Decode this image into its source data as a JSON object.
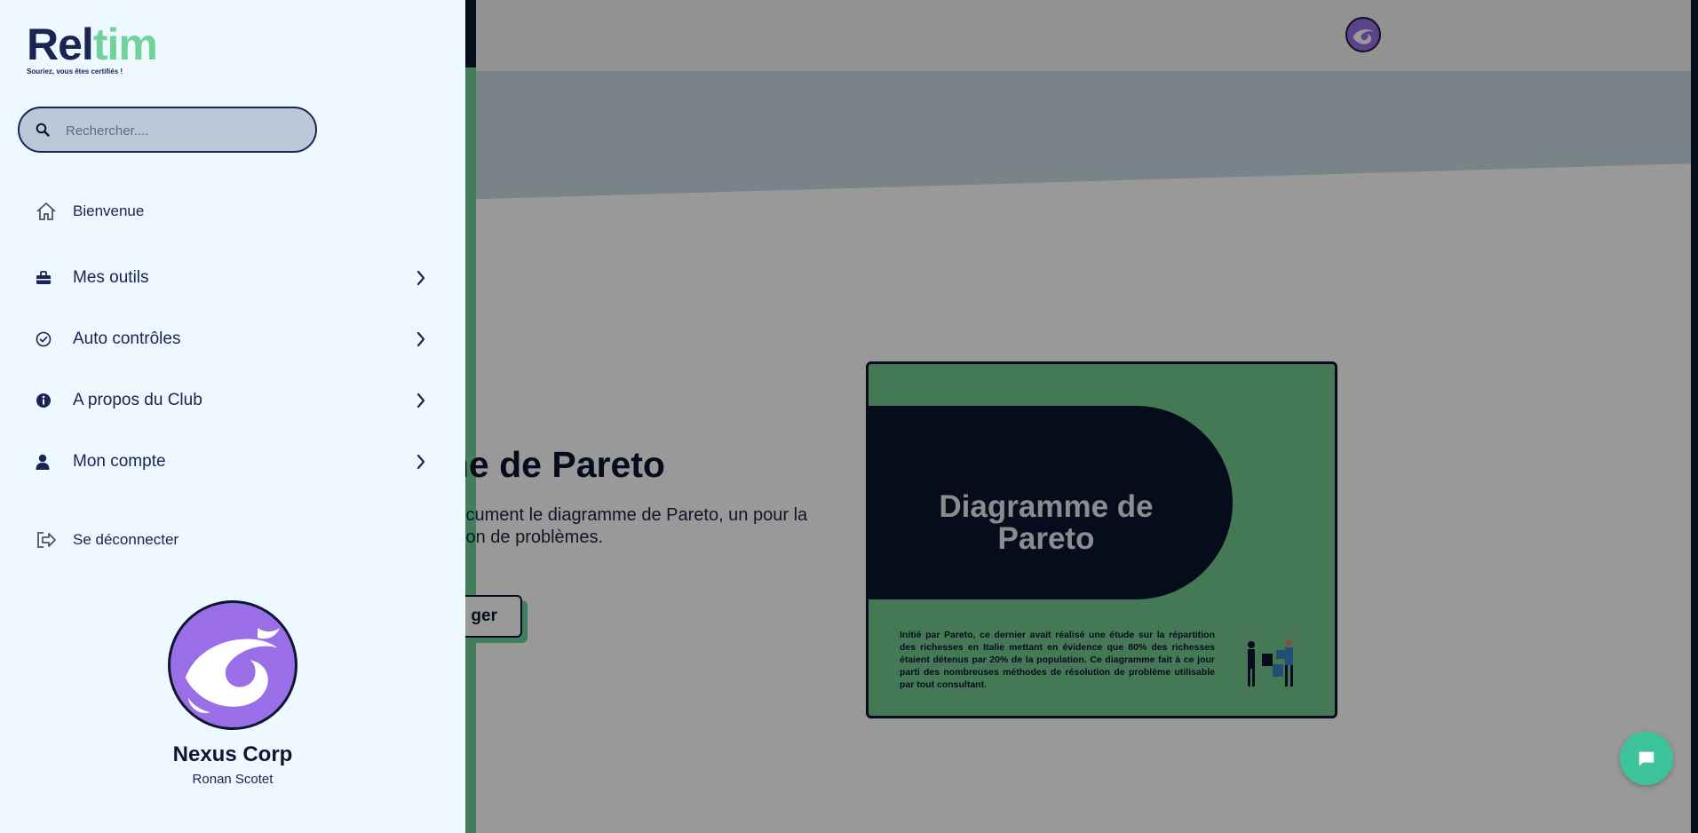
{
  "brand": {
    "logo_part1": "Rel",
    "logo_part2": "tim",
    "tagline": "Souriez, vous êtes certifiés !"
  },
  "search": {
    "placeholder": "Rechercher...."
  },
  "nav": {
    "welcome": "Bienvenue",
    "tools": "Mes outils",
    "self_checks": "Auto contrôles",
    "about": "A propos du Club",
    "account": "Mon compte",
    "logout": "Se déconnecter"
  },
  "profile": {
    "company": "Nexus Corp",
    "user": "Ronan Scotet"
  },
  "main": {
    "title": "mme de Pareto",
    "description": "s ce document le diagramme de Pareto, un pour la résolution de problèmes.",
    "download_label": "ger",
    "doc_card": {
      "title": "Diagramme de Pareto",
      "description": "Initié par Pareto, ce dernier avait réalisé une étude sur la répartition des richesses en Italie mettant en évidence que 80% des richesses étaient détenus par 20% de la population. Ce diagramme fait à ce jour parti des nombreuses méthodes de résolution de problème utilisable par tout consultant."
    }
  },
  "colors": {
    "navy": "#0d1530",
    "accent_green": "#6fd39a",
    "avatar_purple": "#9a6ee6",
    "drawer_bg": "#edf8ff"
  },
  "icons": [
    "search-icon",
    "home-icon",
    "toolbox-icon",
    "check-circle-icon",
    "info-icon",
    "user-icon",
    "logout-icon",
    "chevron-right-icon",
    "chat-icon"
  ]
}
